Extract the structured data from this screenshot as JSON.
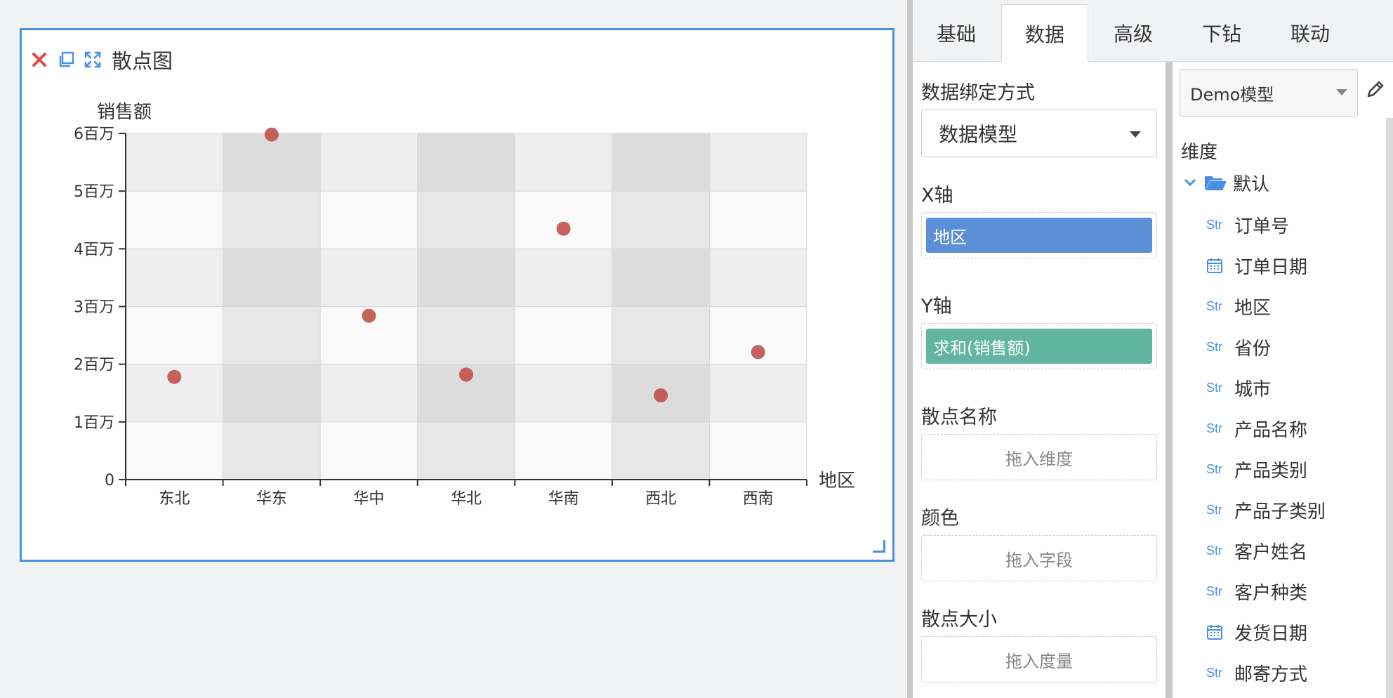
{
  "widget": {
    "title": "散点图",
    "icons": [
      "close-icon",
      "copy-icon",
      "fullscreen-icon"
    ]
  },
  "chart_data": {
    "type": "scatter",
    "title": "",
    "xlabel": "地区",
    "ylabel": "销售额",
    "categories": [
      "东北",
      "华东",
      "华中",
      "华北",
      "华南",
      "西北",
      "西南"
    ],
    "series": [
      {
        "values": [
          1780000,
          5980000,
          2840000,
          1820000,
          4350000,
          1460000,
          2210000
        ]
      }
    ],
    "ylim": [
      0,
      6000000
    ],
    "yticks": [
      0,
      1000000,
      2000000,
      3000000,
      4000000,
      5000000,
      6000000
    ],
    "ytick_labels": [
      "0",
      "1百万",
      "2百万",
      "3百万",
      "4百万",
      "5百万",
      "6百万"
    ],
    "grid": true,
    "point_color": "#c0504d"
  },
  "tabs": [
    {
      "label": "基础",
      "active": false
    },
    {
      "label": "数据",
      "active": true
    },
    {
      "label": "高级",
      "active": false
    },
    {
      "label": "下钻",
      "active": false
    },
    {
      "label": "联动",
      "active": false
    }
  ],
  "binding": {
    "mode_label": "数据绑定方式",
    "mode_value": "数据模型",
    "x_axis_label": "X轴",
    "x_axis_field": "地区",
    "y_axis_label": "Y轴",
    "y_axis_field": "求和(销售额)",
    "point_name_label": "散点名称",
    "point_name_placeholder": "拖入维度",
    "color_label": "颜色",
    "color_placeholder": "拖入字段",
    "point_size_label": "散点大小",
    "point_size_placeholder": "拖入度量"
  },
  "model": {
    "selected": "Demo模型",
    "dimension_label": "维度",
    "folder": "默认",
    "fields": [
      {
        "type": "Str",
        "name": "订单号"
      },
      {
        "type": "Date",
        "name": "订单日期"
      },
      {
        "type": "Str",
        "name": "地区"
      },
      {
        "type": "Str",
        "name": "省份"
      },
      {
        "type": "Str",
        "name": "城市"
      },
      {
        "type": "Str",
        "name": "产品名称"
      },
      {
        "type": "Str",
        "name": "产品类别"
      },
      {
        "type": "Str",
        "name": "产品子类别"
      },
      {
        "type": "Str",
        "name": "客户姓名"
      },
      {
        "type": "Str",
        "name": "客户种类"
      },
      {
        "type": "Date",
        "name": "发货日期"
      },
      {
        "type": "Str",
        "name": "邮寄方式"
      }
    ]
  },
  "colors": {
    "accent": "#4a90e2",
    "x_pill": "#5b8fd6",
    "y_pill": "#62b5a0",
    "close": "#e04a4a"
  }
}
